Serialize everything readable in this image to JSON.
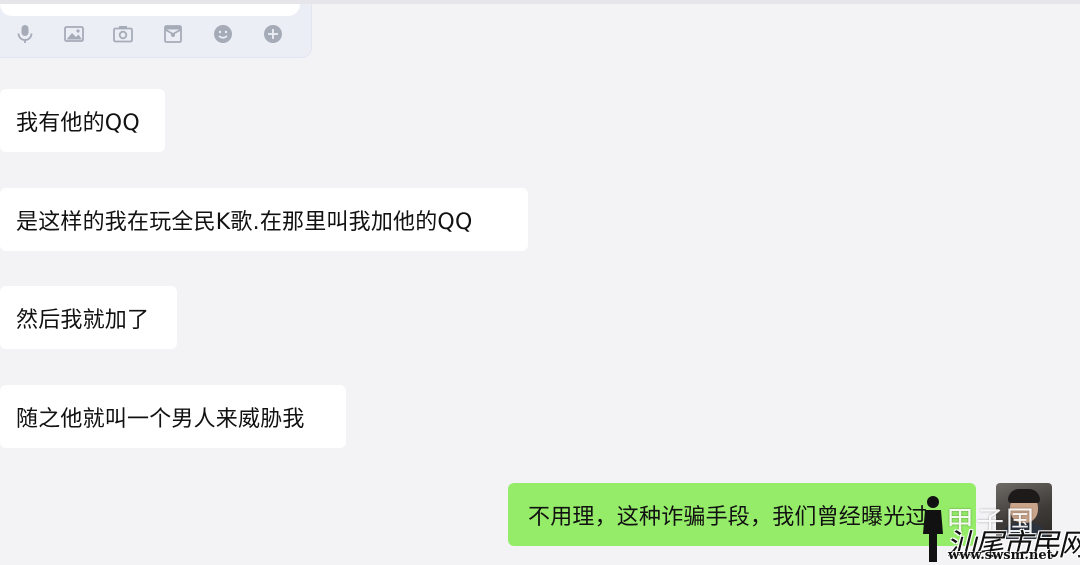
{
  "toolbar": {
    "icons": [
      "microphone-icon",
      "image-icon",
      "camera-icon",
      "red-packet-icon",
      "emoji-icon",
      "plus-circle-icon"
    ]
  },
  "messages": [
    {
      "side": "left",
      "text": "我有他的QQ"
    },
    {
      "side": "left",
      "text": "是这样的我在玩全民K歌.在那里叫我加他的QQ"
    },
    {
      "side": "left",
      "text": "然后我就加了"
    },
    {
      "side": "left",
      "text": "随之他就叫一个男人来威胁我"
    },
    {
      "side": "right",
      "text": "不用理，这种诈骗手段，我们曾经曝光过"
    }
  ],
  "watermarks": {
    "overlay_text": "甲子国",
    "logo_text": "汕尾市民网",
    "logo_url": "www.swsm.net"
  },
  "colors": {
    "background": "#f3f3f6",
    "incoming_bubble": "#ffffff",
    "outgoing_bubble": "#95ec69",
    "toolbar_icon": "#a6abb8"
  }
}
